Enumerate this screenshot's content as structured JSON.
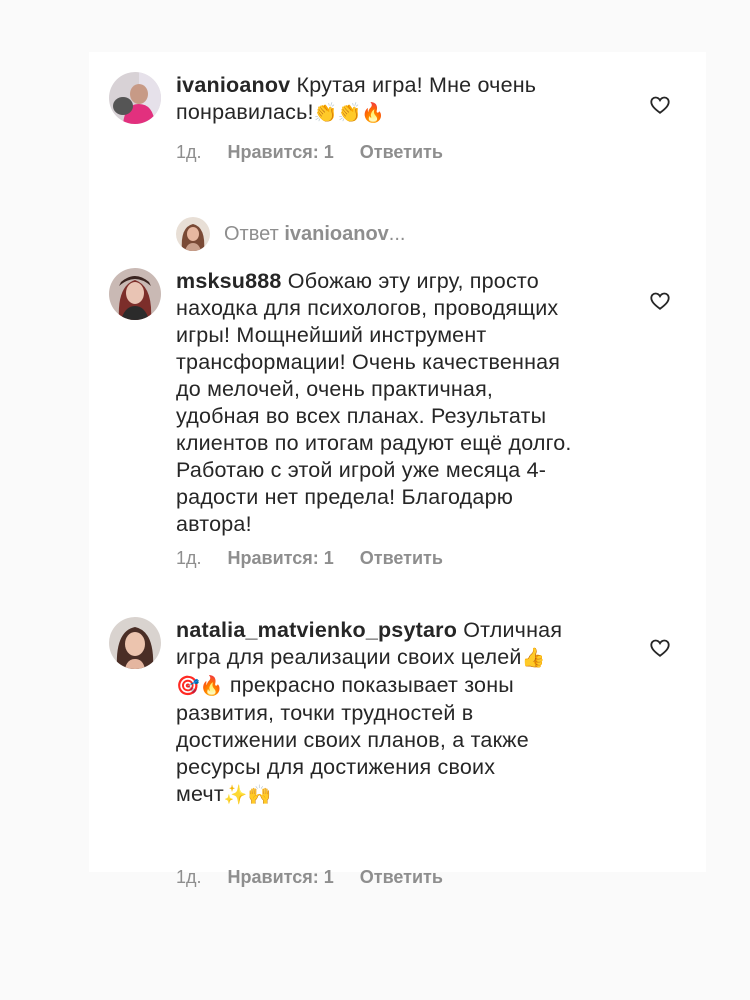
{
  "comments": [
    {
      "username": "ivanioanov",
      "text": "Крутая игра! Мне очень\nпонравилась!",
      "emoji": "👏👏🔥",
      "time": "1д.",
      "likes": "Нравится: 1",
      "reply": "Ответить"
    },
    {
      "username": "msksu888",
      "text": "Обожаю эту игру, просто\nнаходка для психологов, проводящих\nигры! Мощнейший инструмент\nтрансформации! Очень качественная\nдо мелочей, очень практичная,\nудобная во всех планах. Результаты\nклиентов по итогам радуют ещё долго.\nРаботаю с этой игрой уже месяца 4-\nрадости нет предела! Благодарю\nавтора!",
      "time": "1д.",
      "likes": "Нравится: 1",
      "reply": "Ответить"
    },
    {
      "username": "natalia_matvienko_psytaro",
      "text_part1": "Отличная\nигра для реализации своих целей",
      "emoji1": "👍",
      "emoji2": "🎯🔥",
      "text_part2": " прекрасно показывает  зоны\nразвития, точки трудностей в\nдостижении своих планов, а также\nресурсы для достижения своих\nмечт",
      "emoji3": "✨🙌",
      "time": "1д.",
      "likes": "Нравится: 1",
      "reply": "Ответить"
    }
  ],
  "reply_thread": {
    "prefix": "Ответ",
    "username": "ivanioanov",
    "suffix": "..."
  },
  "icons": {
    "like": "heart-outline-icon"
  },
  "colors": {
    "text": "#262626",
    "secondary": "#8e8e8e",
    "background": "#fafafa",
    "card": "#ffffff"
  }
}
